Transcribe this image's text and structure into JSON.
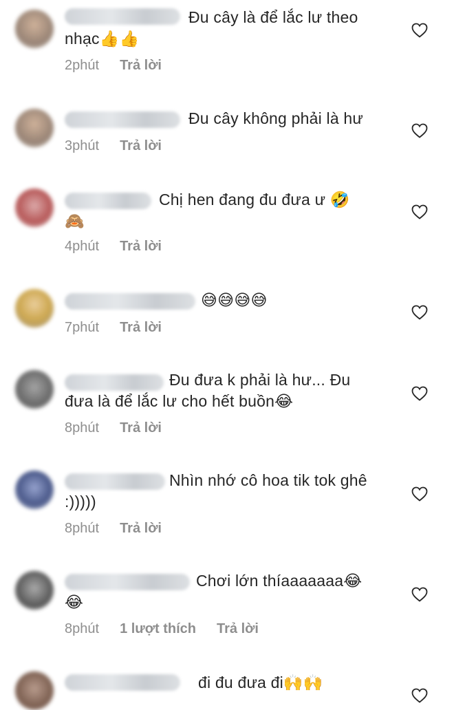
{
  "comments": [
    {
      "text1": "Đu cây là để lắc lư theo",
      "text2": "nhạc👍👍",
      "time": "2phút",
      "reply": "Trả lời"
    },
    {
      "text1": "Đu cây không phải là hư",
      "text2": "",
      "time": "3phút",
      "reply": "Trả lời"
    },
    {
      "text1": "Chị hen đang đu đưa ư 🤣",
      "text2": "🙈",
      "time": "4phút",
      "reply": "Trả lời"
    },
    {
      "text1": "😅😅😅😅",
      "text2": "",
      "time": "7phút",
      "reply": "Trả lời"
    },
    {
      "text1": "Đu đưa k phải là hư... Đu",
      "text2": "đưa là để lắc lư cho hết buồn😂",
      "time": "8phút",
      "reply": "Trả lời"
    },
    {
      "text1": "Nhìn nhớ cô hoa tik tok ghê",
      "text2": ":)))))",
      "time": "8phút",
      "reply": "Trả lời"
    },
    {
      "text1": "Chơi lớn thíaaaaaaa😂",
      "text2": "😂",
      "time": "8phút",
      "likes": "1 lượt thích",
      "reply": "Trả lời"
    },
    {
      "text1": "đi đu đưa đi🙌🙌",
      "text2": "",
      "time": "",
      "reply": ""
    }
  ],
  "colors": {
    "text": "#262626",
    "meta": "#8e8e8e",
    "heart": "#262626"
  },
  "icons": {
    "like": "heart-outline-icon"
  }
}
